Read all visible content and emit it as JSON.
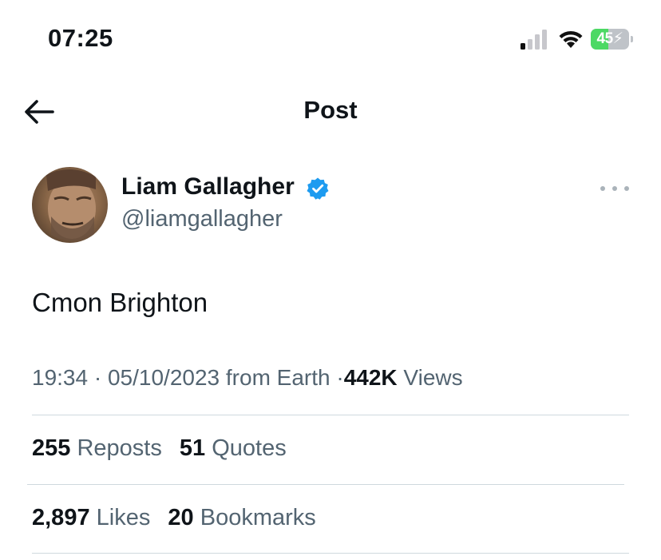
{
  "status_bar": {
    "time": "07:25",
    "battery": "45",
    "battery_color": "#4cd964"
  },
  "header": {
    "title": "Post",
    "back_icon": "arrow-left-icon"
  },
  "author": {
    "name": "Liam Gallagher",
    "handle": "@liamgallagher",
    "verified": true,
    "verified_color": "#1d9bf0"
  },
  "tweet": {
    "text": "Cmon Brighton",
    "time": "19:34",
    "date": "05/10/2023",
    "source": "from Earth",
    "sep": "·",
    "views_count": "442K",
    "views_label": "Views"
  },
  "stats": {
    "reposts_count": "255",
    "reposts_label": "Reposts",
    "quotes_count": "51",
    "quotes_label": "Quotes",
    "likes_count": "2,897",
    "likes_label": "Likes",
    "bookmarks_count": "20",
    "bookmarks_label": "Bookmarks"
  }
}
